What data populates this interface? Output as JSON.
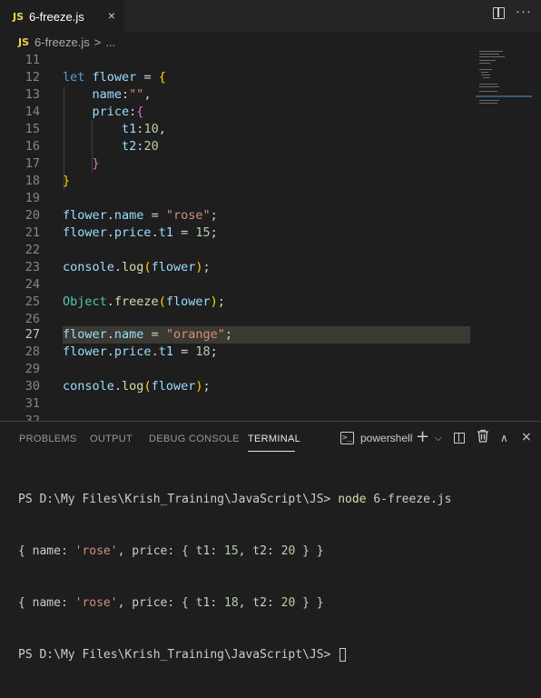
{
  "tab": {
    "icon": "JS",
    "title": "6-freeze.js",
    "close": "×"
  },
  "breadcrumb": {
    "icon": "JS",
    "file": "6-freeze.js",
    "sep": ">",
    "rest": "..."
  },
  "editor": {
    "lines": [
      {
        "n": "11"
      },
      {
        "n": "12"
      },
      {
        "n": "13"
      },
      {
        "n": "14"
      },
      {
        "n": "15"
      },
      {
        "n": "16"
      },
      {
        "n": "17"
      },
      {
        "n": "18"
      },
      {
        "n": "19"
      },
      {
        "n": "20"
      },
      {
        "n": "21"
      },
      {
        "n": "22"
      },
      {
        "n": "23"
      },
      {
        "n": "24"
      },
      {
        "n": "25"
      },
      {
        "n": "26"
      },
      {
        "n": "27"
      },
      {
        "n": "28"
      },
      {
        "n": "29"
      },
      {
        "n": "30"
      },
      {
        "n": "31"
      },
      {
        "n": "32"
      }
    ],
    "tokens": {
      "let": "let",
      "flower": "flower",
      "eq": " = ",
      "lbrace": "{",
      "rbrace": "}",
      "name": "name",
      "colon": ":",
      "emptystr": "\"\"",
      "comma": ",",
      "price": "price",
      "t1": "t1",
      "t2": "t2",
      "v10": "10",
      "v20": "20",
      "dot": ".",
      "rose": "\"rose\"",
      "semi": ";",
      "v15": "15",
      "v18": "18",
      "console": "console",
      "log": "log",
      "lparen": "(",
      "rparen": ")",
      "Object": "Object",
      "freeze": "freeze",
      "orange": "\"orange\""
    }
  },
  "panel": {
    "tabs": [
      "PROBLEMS",
      "OUTPUT",
      "DEBUG CONSOLE",
      "TERMINAL"
    ],
    "shell": "powershell",
    "icons": {
      "plus": "+",
      "chevron": "⌵",
      "trash": "🗑",
      "up": "∧",
      "close": "×"
    }
  },
  "terminal": {
    "prompt": "PS D:\\My Files\\Krish_Training\\JavaScript\\JS>",
    "cmd": "node",
    "arg": "6-freeze.js",
    "out1": {
      "a": "{ name: ",
      "b": "'rose'",
      "c": ", price: { t1: ",
      "d": "15",
      "e": ", t2: ",
      "f": "20",
      "g": " } }"
    },
    "out2": {
      "a": "{ name: ",
      "b": "'rose'",
      "c": ", price: { t1: ",
      "d": "18",
      "e": ", t2: ",
      "f": "20",
      "g": " } }"
    }
  }
}
